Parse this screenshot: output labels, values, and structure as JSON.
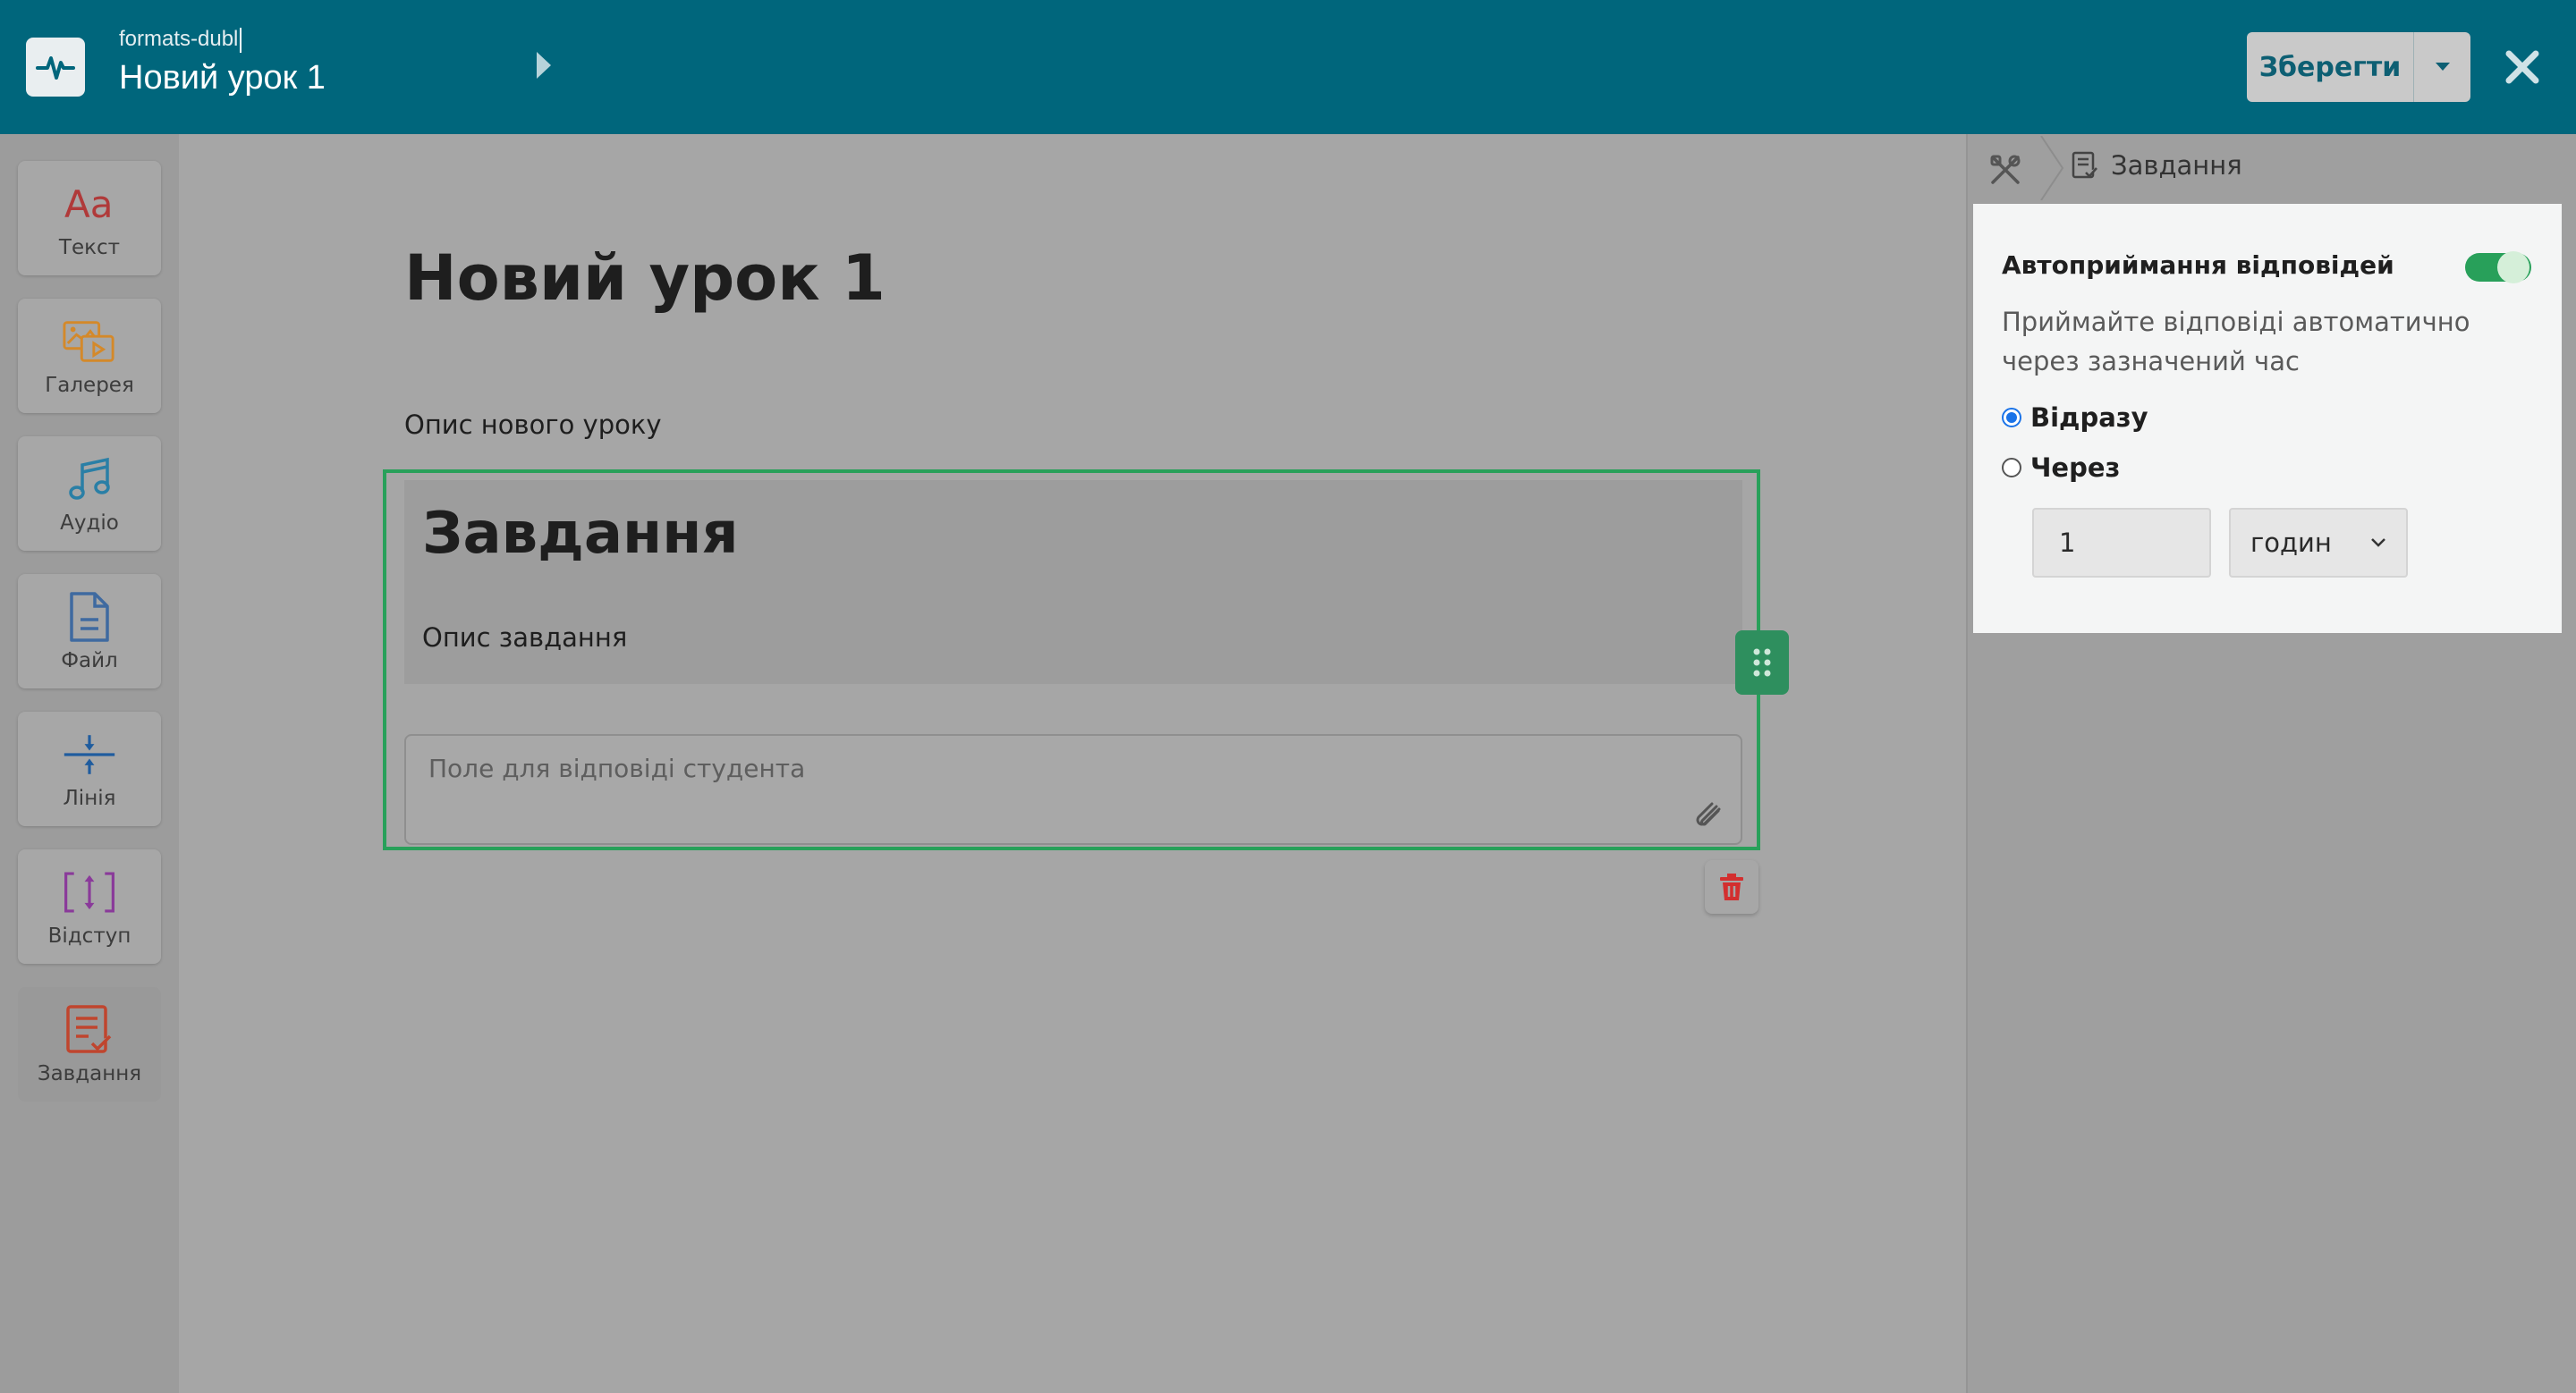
{
  "header": {
    "crumb_small": "formats-dubl",
    "crumb_title": "Новий урок 1",
    "save_label": "Зберегти"
  },
  "sidebar": {
    "items": [
      {
        "label": "Текст",
        "icon": "text-aa-icon",
        "color": "#b03a3a"
      },
      {
        "label": "Галерея",
        "icon": "gallery-icon",
        "color": "#d4892a"
      },
      {
        "label": "Аудіо",
        "icon": "music-note-icon",
        "color": "#2a7fa6"
      },
      {
        "label": "Файл",
        "icon": "file-icon",
        "color": "#3f6aa0"
      },
      {
        "label": "Лінія",
        "icon": "divider-line-icon",
        "color": "#1f5c9e"
      },
      {
        "label": "Відступ",
        "icon": "spacing-icon",
        "color": "#8a3a9a"
      },
      {
        "label": "Завдання",
        "icon": "task-checklist-icon",
        "color": "#c0452e"
      }
    ]
  },
  "editor": {
    "lesson_title": "Новий урок 1",
    "lesson_description": "Опис нового уроку",
    "task": {
      "title": "Завдання",
      "description": "Опис завдання",
      "answer_placeholder": "Поле для відповіді студента"
    }
  },
  "settings": {
    "breadcrumb_label": "Завдання",
    "auto_accept": {
      "title": "Автоприймання відповідей",
      "enabled": true,
      "description": "Приймайте відповіді автоматично через зазначений час",
      "option_immediately": "Відразу",
      "option_after": "Через",
      "selected": "immediately",
      "amount": "1",
      "unit": "годин"
    }
  },
  "colors": {
    "topbar": "#00667c",
    "accent_green": "#28a05a",
    "danger": "#d32f2f"
  }
}
